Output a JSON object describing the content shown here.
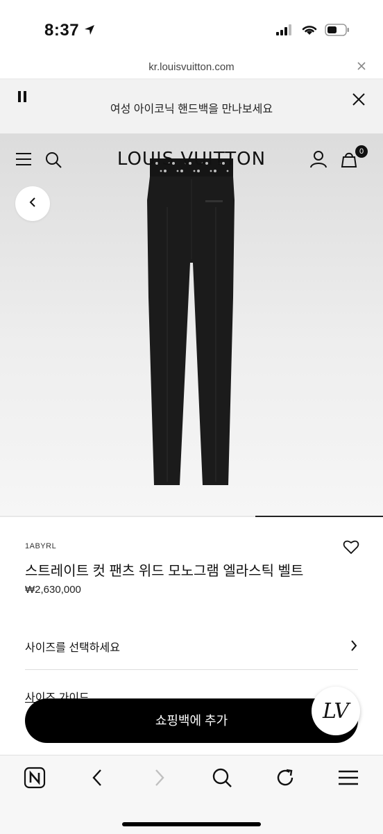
{
  "status_bar": {
    "time": "8:37"
  },
  "browser": {
    "url": "kr.louisvuitton.com"
  },
  "promo": {
    "text": "여성 아이코닉 핸드백을 만나보세요"
  },
  "header": {
    "brand": "LOUIS VUITTON",
    "bag_count": "0"
  },
  "product": {
    "sku": "1ABYRL",
    "name": "스트레이트 컷 팬츠 위드 모노그램 엘라스틱 벨트",
    "price": "₩2,630,000",
    "size_label": "사이즈를 선택하세요",
    "size_guide": "사이즈 가이드",
    "add_to_cart": "쇼핑백에 추가",
    "image_index_fraction": 1.0
  },
  "fab": {
    "label": "LV"
  },
  "icons": [
    "location-arrow-icon",
    "signal-icon",
    "wifi-icon",
    "battery-icon",
    "close-icon",
    "pause-icon",
    "menu-icon",
    "search-icon",
    "account-icon",
    "bag-icon",
    "chevron-left-icon",
    "heart-icon",
    "chevron-right-icon",
    "naver-icon",
    "back-icon",
    "forward-icon",
    "reload-icon",
    "menu-lines-icon"
  ],
  "colors": {
    "accent": "#000000",
    "hero_bg": "#e8e8e8"
  }
}
